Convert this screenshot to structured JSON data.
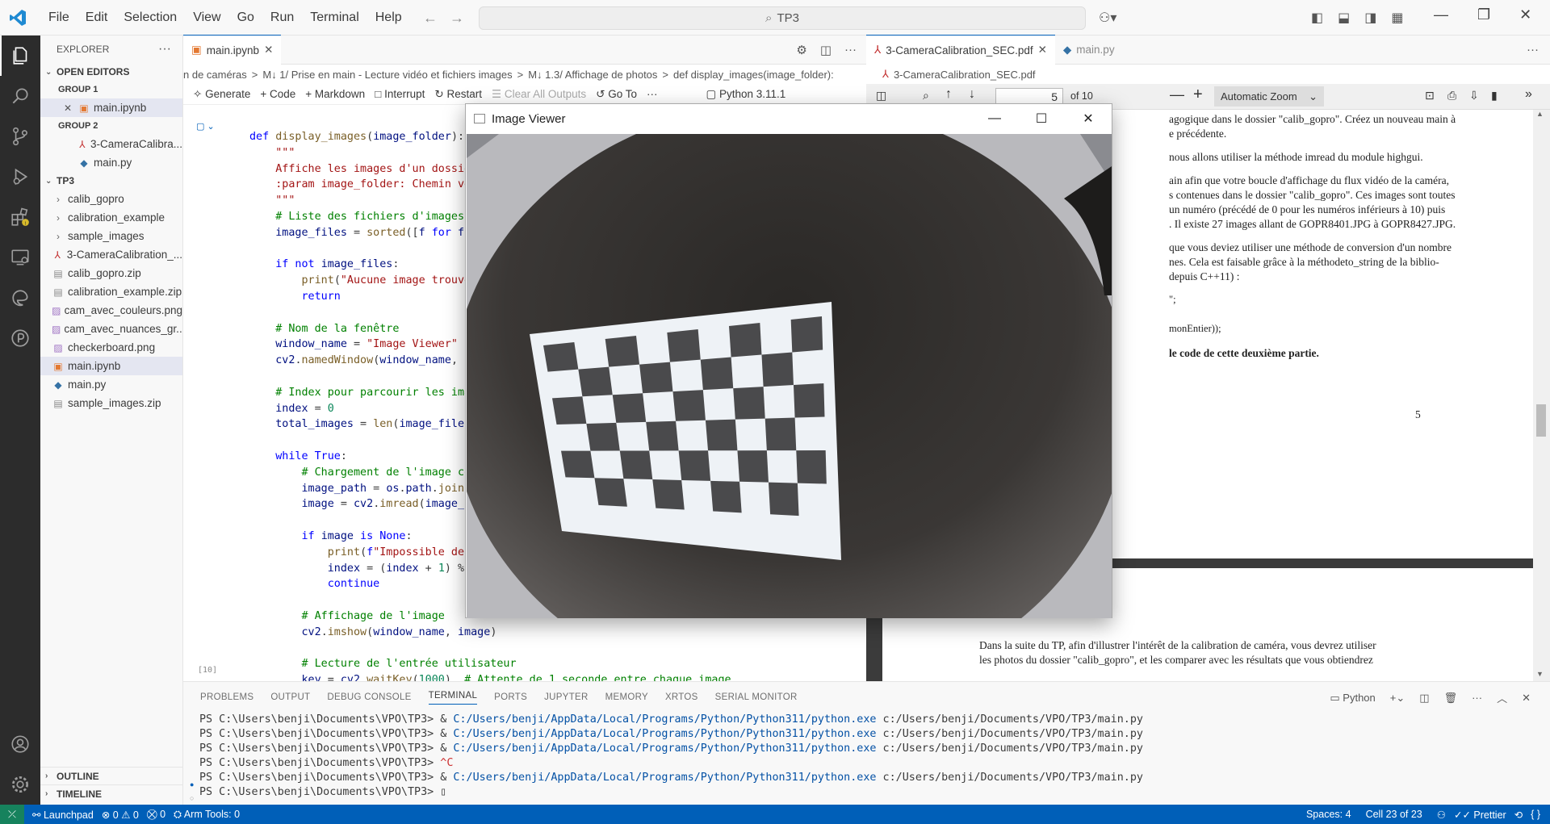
{
  "titlebar": {
    "menu": [
      "File",
      "Edit",
      "Selection",
      "View",
      "Go",
      "Run",
      "Terminal",
      "Help"
    ],
    "search": "TP3"
  },
  "explorer": {
    "title": "EXPLORER",
    "open_editors": "OPEN EDITORS",
    "group1": "GROUP 1",
    "group1_items": [
      "main.ipynb"
    ],
    "group2": "GROUP 2",
    "group2_items": [
      "3-CameraCalibra...",
      "main.py"
    ],
    "folder": "TP3",
    "tree": [
      {
        "name": "calib_gopro",
        "kind": "folder"
      },
      {
        "name": "calibration_example",
        "kind": "folder"
      },
      {
        "name": "sample_images",
        "kind": "folder"
      },
      {
        "name": "3-CameraCalibration_...",
        "kind": "pdf"
      },
      {
        "name": "calib_gopro.zip",
        "kind": "zip"
      },
      {
        "name": "calibration_example.zip",
        "kind": "zip"
      },
      {
        "name": "cam_avec_couleurs.png",
        "kind": "png"
      },
      {
        "name": "cam_avec_nuances_gr...",
        "kind": "png"
      },
      {
        "name": "checkerboard.png",
        "kind": "png"
      },
      {
        "name": "main.ipynb",
        "kind": "nb"
      },
      {
        "name": "main.py",
        "kind": "py"
      },
      {
        "name": "sample_images.zip",
        "kind": "zip"
      }
    ],
    "outline": "OUTLINE",
    "timeline": "TIMELINE"
  },
  "editor1": {
    "tab": "main.ipynb",
    "breadcrumb": [
      "n de caméras",
      ">",
      "M↓ 1/ Prise en main - Lecture vidéo et fichiers images",
      ">",
      "M↓ 1.3/ Affichage de photos",
      ">",
      "def display_images(image_folder):"
    ],
    "toolbar": [
      "Generate",
      "Code",
      "Markdown",
      "Interrupt",
      "Restart",
      "Clear All Outputs",
      "Go To"
    ],
    "kernel": "Python 3.11.1",
    "exec_count": "[10]"
  },
  "editor2": {
    "tabs": [
      "3-CameraCalibration_SEC.pdf",
      "main.py"
    ],
    "breadcrumb": "3-CameraCalibration_SEC.pdf",
    "page_num": "5",
    "page_of": "of 10",
    "zoom": "Automatic Zoom",
    "page_number_footer": "5",
    "pdf_lines": [
      "agogique dans le dossier \"calib_gopro\". Créez un nouveau main à",
      "e précédente.",
      "nous allons utiliser la méthode imread du module highgui.",
      "ain afin que votre boucle d'affichage du flux vidéo de la caméra,",
      "s contenues dans le dossier \"calib_gopro\". Ces images sont toutes",
      "un numéro (précédé de 0 pour les numéros inférieurs à 10) puis",
      ". Il existe 27 images allant de GOPR8401.JPG à GOPR8427.JPG.",
      "que vous deviez utiliser une méthode de conversion d'un nombre",
      "nes. Cela est faisable grâce à la méthodeto_string de la biblio-",
      "depuis C++11) :",
      "\";",
      "monEntier));",
      "le code de cette deuxième partie.",
      "Dans la suite du TP, afin d'illustrer l'intérêt de la calibration de caméra, vous devrez utiliser",
      "les photos du dossier \"calib_gopro\", et les comparer avec les résultats que vous obtiendrez"
    ]
  },
  "image_viewer": {
    "title": "Image Viewer"
  },
  "panel": {
    "tabs": [
      "PROBLEMS",
      "OUTPUT",
      "DEBUG CONSOLE",
      "TERMINAL",
      "PORTS",
      "JUPYTER",
      "MEMORY",
      "XRTOS",
      "SERIAL MONITOR"
    ],
    "shell": "Python",
    "lines": [
      {
        "prompt": "PS C:\\Users\\benji\\Documents\\VPO\\TP3> & ",
        "exe": "C:/Users/benji/AppData/Local/Programs/Python/Python311/python.exe",
        "arg": " c:/Users/benji/Documents/VPO/TP3/main.py"
      },
      {
        "prompt": "PS C:\\Users\\benji\\Documents\\VPO\\TP3> & ",
        "exe": "C:/Users/benji/AppData/Local/Programs/Python/Python311/python.exe",
        "arg": " c:/Users/benji/Documents/VPO/TP3/main.py"
      },
      {
        "prompt": "PS C:\\Users\\benji\\Documents\\VPO\\TP3> & ",
        "exe": "C:/Users/benji/AppData/Local/Programs/Python/Python311/python.exe",
        "arg": " c:/Users/benji/Documents/VPO/TP3/main.py"
      },
      {
        "prompt": "PS C:\\Users\\benji\\Documents\\VPO\\TP3> ",
        "exe": "^C",
        "arg": ""
      },
      {
        "prompt": "PS C:\\Users\\benji\\Documents\\VPO\\TP3> & ",
        "exe": "C:/Users/benji/AppData/Local/Programs/Python/Python311/python.exe",
        "arg": " c:/Users/benji/Documents/VPO/TP3/main.py"
      },
      {
        "prompt": "PS C:\\Users\\benji\\Documents\\VPO\\TP3> ",
        "exe": "",
        "arg": ""
      }
    ]
  },
  "statusbar": {
    "remote": "Launchpad",
    "errors": "0",
    "warnings": "0",
    "ports": "0",
    "arm": "Arm Tools: 0",
    "spaces": "Spaces: 4",
    "cell": "Cell 23 of 23",
    "prettier": "Prettier"
  },
  "colors": {
    "accent": "#005fb8",
    "activity": "#2c2c2c"
  }
}
